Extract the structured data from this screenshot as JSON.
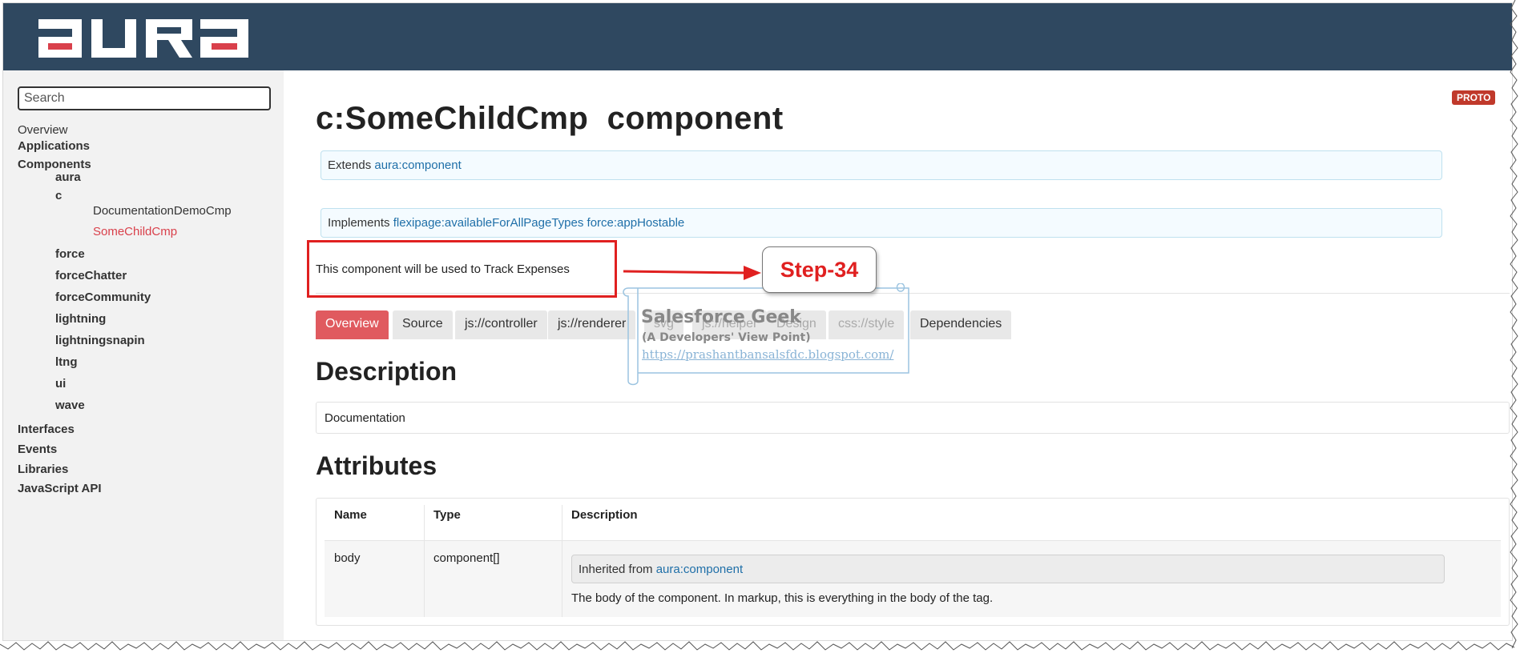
{
  "header": {
    "logo_text": "aura"
  },
  "sidebar": {
    "search_placeholder": "Search",
    "items": [
      {
        "label": "Overview"
      },
      {
        "label": "Applications"
      },
      {
        "label": "Components"
      },
      {
        "label": "aura"
      },
      {
        "label": "c"
      },
      {
        "label": "DocumentationDemoCmp"
      },
      {
        "label": "SomeChildCmp"
      },
      {
        "label": "force"
      },
      {
        "label": "forceChatter"
      },
      {
        "label": "forceCommunity"
      },
      {
        "label": "lightning"
      },
      {
        "label": "lightningsnapin"
      },
      {
        "label": "ltng"
      },
      {
        "label": "ui"
      },
      {
        "label": "wave"
      },
      {
        "label": "Interfaces"
      },
      {
        "label": "Events"
      },
      {
        "label": "Libraries"
      },
      {
        "label": "JavaScript API"
      }
    ],
    "active_item": "SomeChildCmp"
  },
  "main": {
    "badge": "PROTO",
    "title": "c:SomeChildCmp  component",
    "extends_label": "Extends",
    "extends_link": "aura:component",
    "implements_label": "Implements",
    "implements_links": [
      "flexipage:availableForAllPageTypes",
      "force:appHostable"
    ],
    "description_line": "This component will be used to Track Expenses",
    "tabs": [
      {
        "label": "Overview"
      },
      {
        "label": "Source"
      },
      {
        "label": "js://controller"
      },
      {
        "label": "js://renderer"
      },
      {
        "label": "svg"
      },
      {
        "label": "js://helper"
      },
      {
        "label": "Design"
      },
      {
        "label": "css://style"
      },
      {
        "label": "Dependencies"
      }
    ],
    "active_tab": "Overview",
    "description_heading": "Description",
    "description_text": "Documentation",
    "attributes_heading": "Attributes",
    "attributes_table": {
      "columns": [
        "Name",
        "Type",
        "Description"
      ],
      "rows": [
        {
          "name": "body",
          "type": "component[]",
          "inherited_label": "Inherited from",
          "inherited_link": "aura:component",
          "description": "The body of the component. In markup, this is everything in the body of the tag."
        }
      ]
    }
  },
  "annotation": {
    "step_label": "Step-34",
    "color": "#e02020"
  },
  "watermark": {
    "title": "Salesforce Geek",
    "subtitle": "(A Developers' View Point)",
    "url": "https://prashantbansalsfdc.blogspot.com/"
  },
  "colors": {
    "header_bg": "#2f4860",
    "sidebar_bg": "#f2f2f2",
    "active_tab_bg": "#e05a5f",
    "link": "#1f6fa8",
    "active_nav": "#d9404b"
  }
}
